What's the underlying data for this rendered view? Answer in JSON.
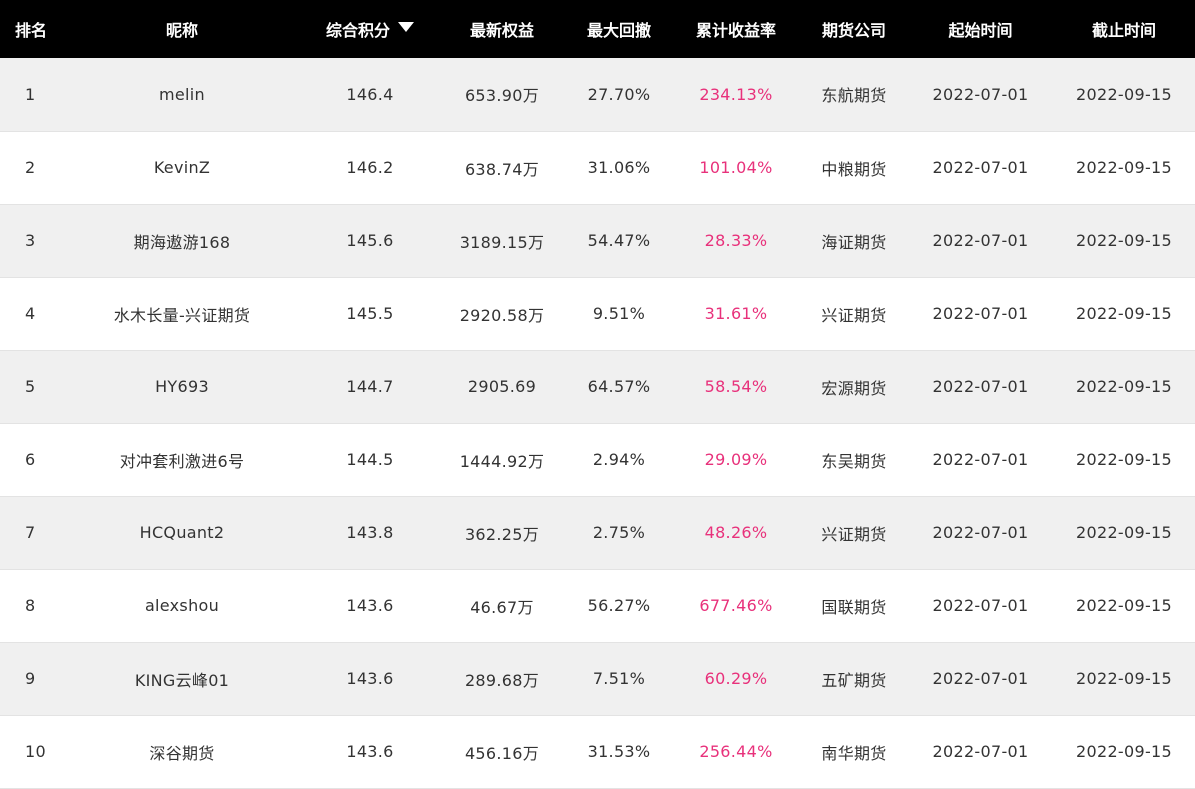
{
  "header": {
    "rank": "排名",
    "nickname": "昵称",
    "score": "综合积分",
    "equity": "最新权益",
    "max_drawdown": "最大回撤",
    "cumulative_return": "累计收益率",
    "futures_company": "期货公司",
    "start_date": "起始时间",
    "end_date": "截止时间",
    "sort_icon": "caret-down-icon"
  },
  "colors": {
    "header_bg": "#000000",
    "header_text": "#ffffff",
    "row_odd": "#f0f0f0",
    "row_even": "#ffffff",
    "return_text": "#e8317b",
    "body_text": "#333333"
  },
  "rows": [
    {
      "rank": "1",
      "nickname": "melin",
      "score": "146.4",
      "equity": "653.90万",
      "max_drawdown": "27.70%",
      "cumulative_return": "234.13%",
      "futures_company": "东航期货",
      "start_date": "2022-07-01",
      "end_date": "2022-09-15"
    },
    {
      "rank": "2",
      "nickname": "KevinZ",
      "score": "146.2",
      "equity": "638.74万",
      "max_drawdown": "31.06%",
      "cumulative_return": "101.04%",
      "futures_company": "中粮期货",
      "start_date": "2022-07-01",
      "end_date": "2022-09-15"
    },
    {
      "rank": "3",
      "nickname": "期海遨游168",
      "score": "145.6",
      "equity": "3189.15万",
      "max_drawdown": "54.47%",
      "cumulative_return": "28.33%",
      "futures_company": "海证期货",
      "start_date": "2022-07-01",
      "end_date": "2022-09-15"
    },
    {
      "rank": "4",
      "nickname": "水木长量-兴证期货",
      "score": "145.5",
      "equity": "2920.58万",
      "max_drawdown": "9.51%",
      "cumulative_return": "31.61%",
      "futures_company": "兴证期货",
      "start_date": "2022-07-01",
      "end_date": "2022-09-15"
    },
    {
      "rank": "5",
      "nickname": "HY693",
      "score": "144.7",
      "equity": "2905.69",
      "max_drawdown": "64.57%",
      "cumulative_return": "58.54%",
      "futures_company": "宏源期货",
      "start_date": "2022-07-01",
      "end_date": "2022-09-15"
    },
    {
      "rank": "6",
      "nickname": "对冲套利激进6号",
      "score": "144.5",
      "equity": "1444.92万",
      "max_drawdown": "2.94%",
      "cumulative_return": "29.09%",
      "futures_company": "东吴期货",
      "start_date": "2022-07-01",
      "end_date": "2022-09-15"
    },
    {
      "rank": "7",
      "nickname": "HCQuant2",
      "score": "143.8",
      "equity": "362.25万",
      "max_drawdown": "2.75%",
      "cumulative_return": "48.26%",
      "futures_company": "兴证期货",
      "start_date": "2022-07-01",
      "end_date": "2022-09-15"
    },
    {
      "rank": "8",
      "nickname": "alexshou",
      "score": "143.6",
      "equity": "46.67万",
      "max_drawdown": "56.27%",
      "cumulative_return": "677.46%",
      "futures_company": "国联期货",
      "start_date": "2022-07-01",
      "end_date": "2022-09-15"
    },
    {
      "rank": "9",
      "nickname": "KING云峰01",
      "score": "143.6",
      "equity": "289.68万",
      "max_drawdown": "7.51%",
      "cumulative_return": "60.29%",
      "futures_company": "五矿期货",
      "start_date": "2022-07-01",
      "end_date": "2022-09-15"
    },
    {
      "rank": "10",
      "nickname": "深谷期货",
      "score": "143.6",
      "equity": "456.16万",
      "max_drawdown": "31.53%",
      "cumulative_return": "256.44%",
      "futures_company": "南华期货",
      "start_date": "2022-07-01",
      "end_date": "2022-09-15"
    }
  ]
}
